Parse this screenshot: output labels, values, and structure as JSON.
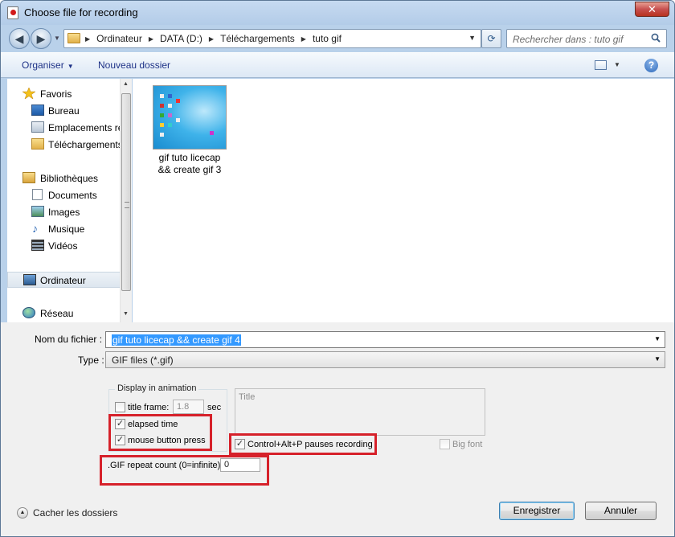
{
  "window": {
    "title": "Choose file for recording",
    "close_glyph": "✕"
  },
  "address": {
    "crumbs": [
      "Ordinateur",
      "DATA (D:)",
      "Téléchargements",
      "tuto gif"
    ],
    "search_placeholder": "Rechercher dans : tuto gif"
  },
  "toolbar": {
    "organize_label": "Organiser",
    "new_folder_label": "Nouveau dossier",
    "help_glyph": "?"
  },
  "nav": {
    "items": [
      {
        "label": "Favoris",
        "icon": "star-icon"
      },
      {
        "label": "Bureau",
        "icon": "desktop-icon"
      },
      {
        "label": "Emplacements ré",
        "icon": "recent-places-icon"
      },
      {
        "label": "Téléchargements",
        "icon": "downloads-folder-icon"
      },
      {
        "label": "Bibliothèques",
        "icon": "libraries-icon"
      },
      {
        "label": "Documents",
        "icon": "documents-icon"
      },
      {
        "label": "Images",
        "icon": "images-icon"
      },
      {
        "label": "Musique",
        "icon": "music-icon"
      },
      {
        "label": "Vidéos",
        "icon": "videos-icon"
      },
      {
        "label": "Ordinateur",
        "icon": "computer-icon"
      },
      {
        "label": "Réseau",
        "icon": "network-icon"
      }
    ]
  },
  "files": [
    {
      "line1": "gif tuto licecap",
      "line2": "&& create gif 3"
    }
  ],
  "form": {
    "filename_label": "Nom du fichier :",
    "filename_value": "gif tuto licecap && create gif 4",
    "type_label": "Type :",
    "type_value": "GIF files (*.gif)"
  },
  "options": {
    "group_title": "Display in animation",
    "title_frame_label": "title frame:",
    "title_frame_value": "1.8",
    "title_frame_unit": "sec",
    "title_frame_checked": false,
    "elapsed_time_label": "elapsed time",
    "elapsed_time_checked": true,
    "mouse_press_label": "mouse button press",
    "mouse_press_checked": true,
    "title_placeholder": "Title",
    "pause_label": "Control+Alt+P pauses recording",
    "pause_checked": true,
    "big_font_label": "Big font",
    "big_font_checked": false,
    "repeat_label": ".GIF repeat count (0=infinite):",
    "repeat_value": "0"
  },
  "footer": {
    "toggle_label": "Cacher les dossiers",
    "save_label": "Enregistrer",
    "cancel_label": "Annuler"
  },
  "colors": {
    "highlight_red": "#d6212a",
    "selection_blue": "#3399ff"
  }
}
